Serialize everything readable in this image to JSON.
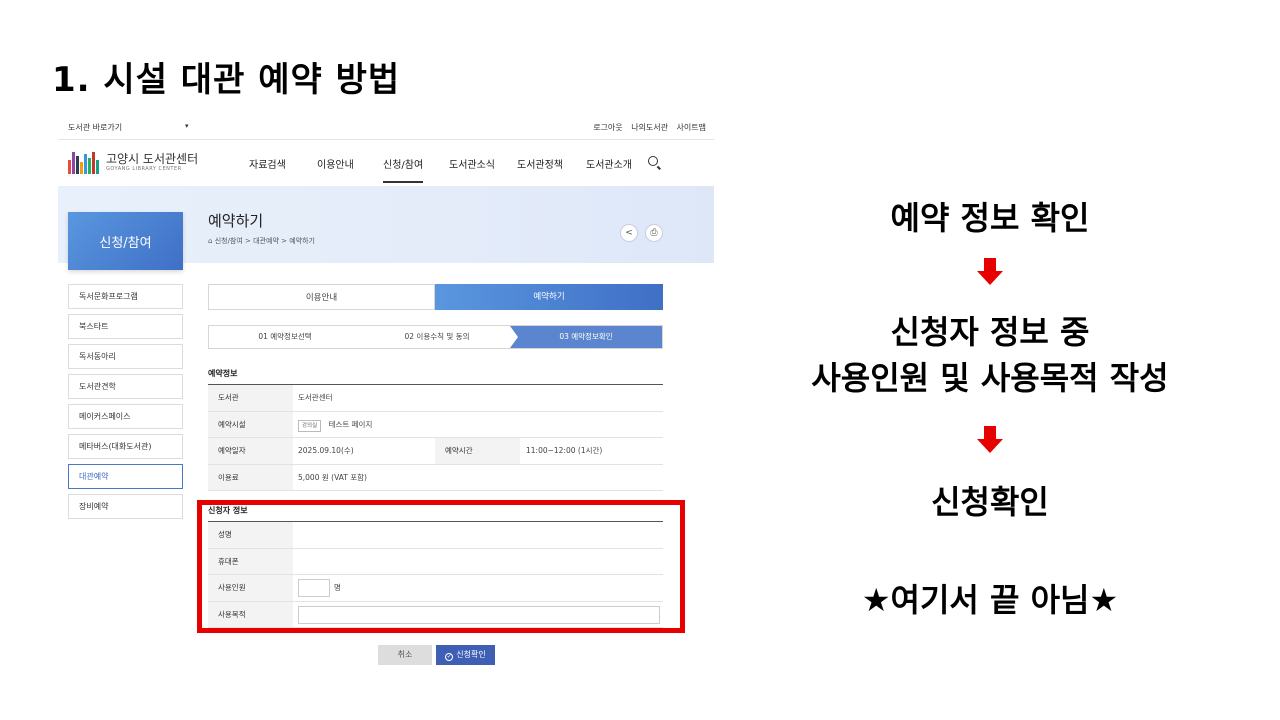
{
  "slide": {
    "title": "1. 시설 대관 예약 방법"
  },
  "topbar": {
    "branch_select": "도서관 바로가기",
    "util_links": [
      "로그아웃",
      "나의도서관",
      "사이트맵"
    ]
  },
  "header": {
    "logo_name": "고양시 도서관센터",
    "logo_sub": "GOYANG LIBRARY CENTER",
    "menu": [
      "자료검색",
      "이용안내",
      "신청/참여",
      "도서관소식",
      "도서관정책",
      "도서관소개"
    ],
    "active_menu": "신청/참여"
  },
  "banner": {
    "side_title": "신청/참여",
    "page_title": "예약하기",
    "breadcrumb": "신청/참여 > 대관예약 > 예약하기"
  },
  "sidebar": {
    "items": [
      "독서문화프로그램",
      "북스타트",
      "독서동아리",
      "도서관견학",
      "메이커스페이스",
      "메타버스(대화도서관)",
      "대관예약",
      "장비예약"
    ],
    "active": "대관예약"
  },
  "tabs": {
    "info": "이용안내",
    "reserve": "예약하기"
  },
  "steps": [
    "01 예약정보선택",
    "02 이용수칙 및 동의",
    "03 예약정보확인"
  ],
  "reservation_info": {
    "title": "예약정보",
    "library_label": "도서관",
    "library_value": "도서관센터",
    "facility_label": "예약시설",
    "facility_tag": "강의실",
    "facility_value": "테스트 페이지",
    "date_label": "예약일자",
    "date_value": "2025.09.10(수)",
    "time_label": "예약시간",
    "time_value": "11:00~12:00 (1시간)",
    "fee_label": "이용료",
    "fee_value": "5,000 원 (VAT 포함)"
  },
  "applicant_info": {
    "title": "신청자 정보",
    "name_label": "성명",
    "phone_label": "휴대폰",
    "people_label": "사용인원",
    "people_unit": "명",
    "purpose_label": "사용목적"
  },
  "buttons": {
    "cancel": "취소",
    "confirm": "신청확인"
  },
  "annotations": {
    "step1": "예약 정보 확인",
    "step2_line1": "신청자 정보 중",
    "step2_line2": "사용인원 및 사용목적 작성",
    "step3": "신청확인",
    "note": "★여기서 끝 아님★"
  },
  "colors": {
    "accent": "#3f6fc6",
    "highlight": "#e60000"
  }
}
